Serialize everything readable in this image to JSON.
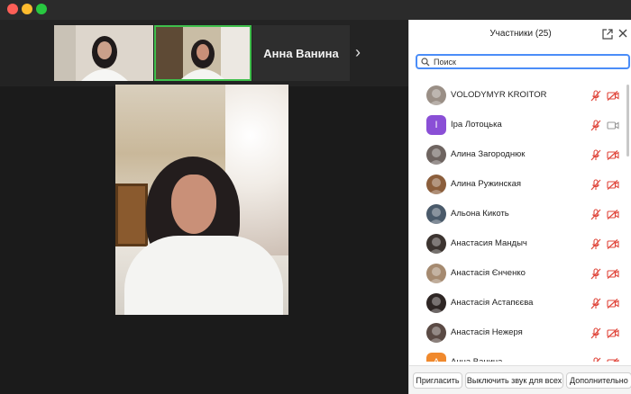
{
  "window": {
    "traffic_lights": [
      "close",
      "minimize",
      "zoom"
    ]
  },
  "video": {
    "thumbnails": [
      {
        "name": "participant-thumbnail-1",
        "active": false
      },
      {
        "name": "participant-thumbnail-2",
        "active": true
      }
    ],
    "active_speaker_name": "Анна Ванина",
    "next_icon": "chevron-right-icon"
  },
  "participants_panel": {
    "title": "Участники (25)",
    "search_placeholder": "Поиск",
    "participants": [
      {
        "name": "VOLODYMYR KROITOR",
        "avatar": "photo",
        "avatar_color": "#9a8f86",
        "mic_muted": true,
        "video_off": true
      },
      {
        "name": "Іра Лотоцька",
        "avatar": "letter",
        "avatar_letter": "І",
        "avatar_color": "#8a4fd6",
        "mic_muted": true,
        "video_off": false
      },
      {
        "name": "Алина Загороднюк",
        "avatar": "photo",
        "avatar_color": "#6e6460",
        "mic_muted": true,
        "video_off": true
      },
      {
        "name": "Алина Ружинская",
        "avatar": "photo",
        "avatar_color": "#8b5e3c",
        "mic_muted": true,
        "video_off": true
      },
      {
        "name": "Альона Кикоть",
        "avatar": "photo",
        "avatar_color": "#4a5a6a",
        "mic_muted": true,
        "video_off": true
      },
      {
        "name": "Анастасия Мандыч",
        "avatar": "photo",
        "avatar_color": "#3c3430",
        "mic_muted": true,
        "video_off": true
      },
      {
        "name": "Анастасія Єнченко",
        "avatar": "photo",
        "avatar_color": "#a58a70",
        "mic_muted": true,
        "video_off": true
      },
      {
        "name": "Анастасія Астапєєва",
        "avatar": "photo",
        "avatar_color": "#2e2624",
        "mic_muted": true,
        "video_off": true
      },
      {
        "name": "Анастасія Нежеря",
        "avatar": "photo",
        "avatar_color": "#5a4a44",
        "mic_muted": true,
        "video_off": true
      },
      {
        "name": "Анна Ванина",
        "avatar": "letter",
        "avatar_letter": "А",
        "avatar_color": "#f0892d",
        "mic_muted": true,
        "video_off": true
      }
    ],
    "footer": {
      "invite_label": "Пригласить",
      "mute_all_label": "Выключить звук для всех",
      "more_label": "Дополнительно"
    },
    "colors": {
      "muted_red": "#e0463b",
      "camera_gray": "#9a9a9a",
      "search_border": "#4b8df8"
    }
  }
}
